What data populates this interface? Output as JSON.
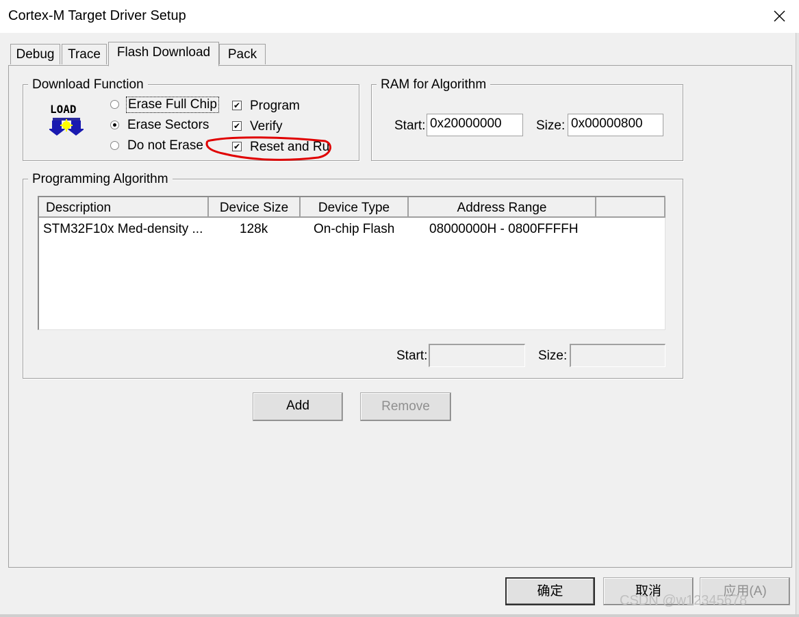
{
  "window": {
    "title": "Cortex-M Target Driver Setup"
  },
  "tabs": [
    {
      "label": "Debug"
    },
    {
      "label": "Trace"
    },
    {
      "label": "Flash Download"
    },
    {
      "label": "Pack"
    }
  ],
  "active_tab": "Flash Download",
  "download_function": {
    "legend": "Download Function",
    "icon_text": "LOAD",
    "erase_options": [
      {
        "label": "Erase Full Chip",
        "selected": false
      },
      {
        "label": "Erase Sectors",
        "selected": true
      },
      {
        "label": "Do not Erase",
        "selected": false
      }
    ],
    "checks": [
      {
        "label": "Program",
        "checked": true
      },
      {
        "label": "Verify",
        "checked": true
      },
      {
        "label": "Reset and Run",
        "checked": true
      }
    ]
  },
  "ram_for_algorithm": {
    "legend": "RAM for Algorithm",
    "start_label": "Start:",
    "start_value": "0x20000000",
    "size_label": "Size:",
    "size_value": "0x00000800"
  },
  "programming_algorithm": {
    "legend": "Programming Algorithm",
    "columns": [
      "Description",
      "Device Size",
      "Device Type",
      "Address Range"
    ],
    "rows": [
      {
        "description": "STM32F10x Med-density ...",
        "device_size": "128k",
        "device_type": "On-chip Flash",
        "address_range": "08000000H - 0800FFFFH"
      }
    ],
    "start_label": "Start:",
    "start_value": "",
    "size_label": "Size:",
    "size_value": ""
  },
  "buttons": {
    "add": "Add",
    "remove": "Remove",
    "ok": "确定",
    "cancel": "取消",
    "apply": "应用(A)"
  },
  "annotation_color": "#e00000",
  "watermark": "CSDN @w12345678"
}
